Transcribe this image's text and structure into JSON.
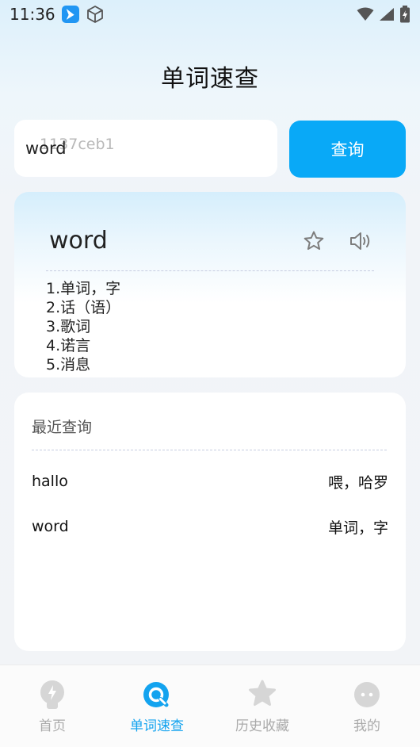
{
  "status_bar": {
    "time": "11:36"
  },
  "header": {
    "title": "单词速查"
  },
  "search": {
    "value": "word",
    "placeholder": "1137ceb1",
    "button_label": "查询"
  },
  "result": {
    "word": "word",
    "definitions": [
      "1.单词，字",
      "2.话（语）",
      "3.歌词",
      "4.诺言",
      "5.消息"
    ]
  },
  "recent": {
    "title": "最近查询",
    "items": [
      {
        "word": "hallo",
        "meaning": "喂，哈罗"
      },
      {
        "word": "word",
        "meaning": "单词，字"
      }
    ]
  },
  "tabs": [
    {
      "label": "首页",
      "icon": "lightbulb-icon",
      "active": false
    },
    {
      "label": "单词速查",
      "icon": "search-icon",
      "active": true
    },
    {
      "label": "历史收藏",
      "icon": "star-icon",
      "active": false
    },
    {
      "label": "我的",
      "icon": "face-icon",
      "active": false
    }
  ],
  "colors": {
    "accent": "#09a9f7",
    "tab_active": "#13a3ef",
    "tab_inactive": "#d6d6d6"
  }
}
